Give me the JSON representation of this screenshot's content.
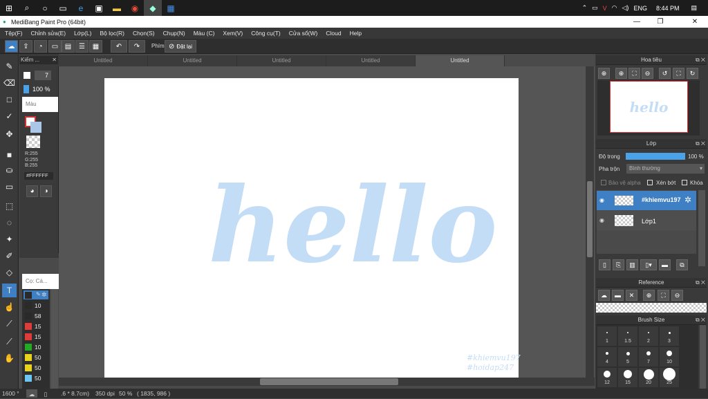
{
  "taskbar": {
    "tray_lang": "ENG",
    "tray_time": "8:44 PM"
  },
  "window": {
    "title": "MediBang Paint Pro (64bit)",
    "minimize": "—",
    "maximize": "❐",
    "close": "✕"
  },
  "menu": [
    "Tệp(F)",
    "Chỉnh sửa(E)",
    "Lớp(L)",
    "Bộ lọc(R)",
    "Chọn(S)",
    "Chụp(N)",
    "Màu (C)",
    "Xem(V)",
    "Công cụ(T)",
    "Cửa sổ(W)",
    "Cloud",
    "Help"
  ],
  "toolbar": {
    "stabilizer_label": "Phím",
    "reset_label": "Đặt lại"
  },
  "brush_panel": {
    "title": "Kiểm ...",
    "size": "7",
    "opacity": "100 %"
  },
  "color_panel": {
    "title": "Màu",
    "r": "R:255",
    "g": "G:255",
    "b": "B:255",
    "hex": "#FFFFFF"
  },
  "brush_list": {
    "title": "Cọ: Cá...",
    "items": [
      "10",
      "58",
      "15",
      "15",
      "10",
      "50",
      "50",
      "50"
    ],
    "colors": [
      "#2a2a2a",
      "#2a2a2a",
      "#e03a3a",
      "#e03a3a",
      "#22aa22",
      "#e8d21c",
      "#e8d21c",
      "#6ec6f0"
    ]
  },
  "tabs": [
    "Untitled",
    "Untitled",
    "Untitled",
    "Untitled",
    "Untitled"
  ],
  "canvas": {
    "main_text": "hello",
    "watermark_1": "#khiemvu197",
    "watermark_2": "#hoidap247",
    "lettering_color": "#c4ddf6"
  },
  "navigator": {
    "title": "Hoa tiêu"
  },
  "layers": {
    "title": "Lớp",
    "opacity_label": "Độ trong",
    "opacity_value": "100 %",
    "blend_label": "Pha trộn",
    "blend_value": "Bình thường",
    "protect_alpha": "Bảo vệ alpha",
    "clip": "Xén bớt",
    "lock": "Khóa",
    "items": [
      {
        "name": "#khiemvu197",
        "selected": true
      },
      {
        "name": "Lớp1",
        "selected": false
      }
    ]
  },
  "reference": {
    "title": "Reference"
  },
  "brush_size": {
    "title": "Brush Size",
    "sizes": [
      "1",
      "1.5",
      "2",
      "3",
      "4",
      "5",
      "7",
      "10",
      "12",
      "15",
      "20",
      "25"
    ]
  },
  "status": {
    "dimensions": ".6 * 8.7cm)",
    "dpi": "350 dpi",
    "zoom": "50 %",
    "coords": "( 1835, 986 )",
    "left_zoom": "1600 °"
  },
  "accent": "#3f7fc4"
}
